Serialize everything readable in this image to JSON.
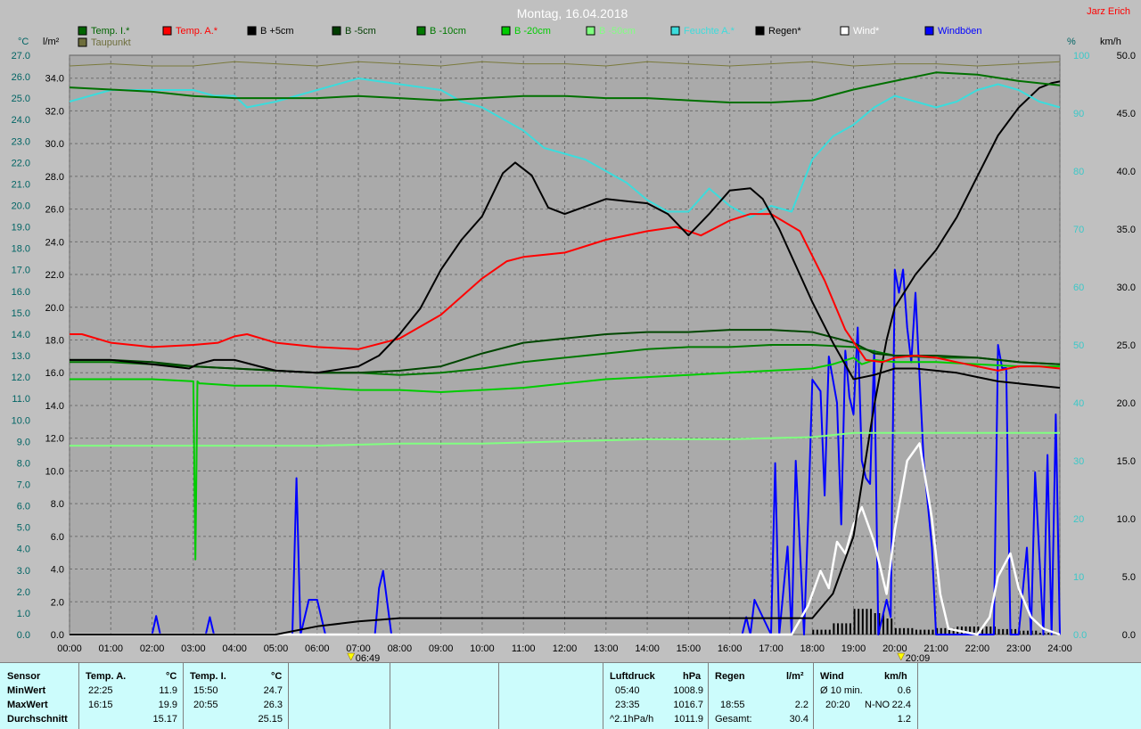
{
  "title": "Montag, 16.04.2018",
  "author": "Jarz Erich",
  "colors": {
    "temp_i": "#006400",
    "temp_a": "#ff0000",
    "b5": "#000000",
    "b_5": "#003c00",
    "b10": "#007800",
    "b20": "#00cc00",
    "b50": "#80ff80",
    "humidity": "#3cdcdc",
    "rain": "#000000",
    "wind": "#ffffff",
    "gusts": "#0000ff",
    "dew": "#6e6e3c"
  },
  "legend": [
    {
      "label": "Temp. I.*",
      "color": "#006400"
    },
    {
      "label": "Temp. A.*",
      "color": "#ff0000"
    },
    {
      "label": "B +5cm",
      "color": "#000000"
    },
    {
      "label": "B -5cm",
      "color": "#003c00"
    },
    {
      "label": "B -10cm",
      "color": "#007800"
    },
    {
      "label": "B -20cm",
      "color": "#00cc00"
    },
    {
      "label": "B -50cm",
      "color": "#80ff80"
    },
    {
      "label": "Feuchte A.*",
      "color": "#3cdcdc"
    },
    {
      "label": "Regen*",
      "color": "#000000"
    },
    {
      "label": "Wind*",
      "color": "#ffffff"
    },
    {
      "label": "Windböen",
      "color": "#0000ff"
    },
    {
      "label": "Taupunkt",
      "color": "#6e6e3c"
    }
  ],
  "chart_data": {
    "type": "line",
    "title": "Montag, 16.04.2018",
    "axes": {
      "left1": {
        "unit": "°C",
        "ylim": [
          0,
          27
        ],
        "ticks": [
          "0.0",
          "1.0",
          "2.0",
          "3.0",
          "4.0",
          "5.0",
          "6.0",
          "7.0",
          "8.0",
          "9.0",
          "10.0",
          "11.0",
          "12.0",
          "13.0",
          "14.0",
          "15.0",
          "16.0",
          "17.0",
          "18.0",
          "19.0",
          "20.0",
          "21.0",
          "22.0",
          "23.0",
          "24.0",
          "25.0",
          "26.0",
          "27.0"
        ]
      },
      "left2": {
        "unit": "l/m²",
        "ylim": [
          0,
          35.4
        ],
        "ticks": [
          "0.0",
          "2.0",
          "4.0",
          "6.0",
          "8.0",
          "10.0",
          "12.0",
          "14.0",
          "16.0",
          "18.0",
          "20.0",
          "22.0",
          "24.0",
          "26.0",
          "28.0",
          "30.0",
          "32.0",
          "34.0"
        ]
      },
      "right1": {
        "unit": "%",
        "ylim": [
          0,
          100
        ],
        "ticks": [
          "0.0",
          "10",
          "20",
          "30",
          "40",
          "50",
          "60",
          "70",
          "80",
          "90",
          "100"
        ]
      },
      "right2": {
        "unit": "km/h",
        "ylim": [
          0,
          50
        ],
        "ticks": [
          "0.0",
          "5.0",
          "10.0",
          "15.0",
          "20.0",
          "25.0",
          "30.0",
          "35.0",
          "40.0",
          "45.0",
          "50.0"
        ]
      },
      "x": {
        "ticks": [
          "00:00",
          "01:00",
          "02:00",
          "03:00",
          "04:00",
          "05:00",
          "06:00",
          "07:00",
          "08:00",
          "09:00",
          "10:00",
          "11:00",
          "12:00",
          "13:00",
          "14:00",
          "15:00",
          "16:00",
          "17:00",
          "18:00",
          "19:00",
          "20:00",
          "21:00",
          "22:00",
          "23:00",
          "24:00"
        ]
      }
    },
    "markers": [
      {
        "label": "06:49",
        "x": 6.82
      },
      {
        "label": "20:09",
        "x": 20.15
      }
    ],
    "grid": true,
    "series": [
      {
        "name": "Temp. I.*",
        "axis": "left1",
        "x": [
          0,
          1,
          2,
          3,
          4,
          5,
          6,
          7,
          8,
          9,
          10,
          11,
          12,
          13,
          14,
          15,
          16,
          17,
          18,
          19,
          20,
          21,
          22,
          23,
          24
        ],
        "values": [
          25.5,
          25.4,
          25.3,
          25.1,
          25.0,
          25.0,
          25.0,
          25.1,
          25.0,
          24.9,
          25.0,
          25.1,
          25.1,
          25.0,
          25.0,
          24.9,
          24.8,
          24.8,
          24.9,
          25.4,
          25.8,
          26.2,
          26.1,
          25.8,
          25.6
        ]
      },
      {
        "name": "Temp. A.*",
        "axis": "left1",
        "x": [
          0,
          0.3,
          1,
          2,
          3,
          3.6,
          4,
          4.3,
          5,
          6,
          7,
          8,
          9,
          10,
          10.6,
          11,
          12,
          13,
          14,
          14.7,
          15.3,
          16,
          16.5,
          17,
          17.7,
          18.3,
          18.8,
          19.3,
          19.7,
          20,
          20.5,
          21,
          21.5,
          22,
          22.5,
          23,
          23.5,
          24
        ],
        "values": [
          14.0,
          14.0,
          13.6,
          13.4,
          13.5,
          13.6,
          13.9,
          14.0,
          13.6,
          13.4,
          13.3,
          13.8,
          14.9,
          16.6,
          17.4,
          17.6,
          17.8,
          18.4,
          18.8,
          19.0,
          18.6,
          19.3,
          19.6,
          19.6,
          18.8,
          16.5,
          14.2,
          12.8,
          12.7,
          12.9,
          13.0,
          12.9,
          12.7,
          12.5,
          12.3,
          12.5,
          12.5,
          12.4
        ]
      },
      {
        "name": "B +5cm",
        "axis": "left1",
        "x": [
          0,
          1,
          2,
          2.9,
          3.1,
          3.5,
          4,
          4.6,
          5,
          6,
          7,
          7.5,
          8,
          8.5,
          9,
          9.5,
          10,
          10.5,
          10.8,
          11.2,
          11.6,
          12,
          13,
          13.5,
          14,
          14.5,
          15,
          15.5,
          16,
          16.5,
          16.8,
          17.2,
          17.6,
          18,
          18.5,
          19,
          19.5,
          20,
          20.5,
          21,
          21.5,
          22,
          22.5,
          23,
          23.5,
          24
        ],
        "values": [
          12.8,
          12.8,
          12.6,
          12.4,
          12.6,
          12.8,
          12.8,
          12.5,
          12.3,
          12.2,
          12.5,
          13.0,
          14.0,
          15.2,
          17.0,
          18.4,
          19.5,
          21.5,
          22.0,
          21.4,
          19.9,
          19.6,
          20.3,
          20.2,
          20.1,
          19.6,
          18.6,
          19.6,
          20.7,
          20.8,
          20.3,
          18.9,
          17.2,
          15.5,
          13.6,
          11.9,
          12.1,
          12.4,
          12.4,
          12.3,
          12.2,
          12.0,
          11.8,
          11.7,
          11.6,
          11.5
        ]
      },
      {
        "name": "B -5cm",
        "axis": "left1",
        "x": [
          0,
          1,
          2,
          3,
          4,
          5,
          6,
          7,
          8,
          9,
          10,
          11,
          12,
          13,
          14,
          15,
          16,
          17,
          18,
          19,
          19.5,
          20,
          21,
          22,
          23,
          24
        ],
        "values": [
          12.8,
          12.8,
          12.7,
          12.5,
          12.4,
          12.3,
          12.2,
          12.2,
          12.3,
          12.5,
          13.1,
          13.6,
          13.8,
          14.0,
          14.1,
          14.1,
          14.2,
          14.2,
          14.1,
          13.6,
          13.1,
          13.0,
          13.0,
          12.9,
          12.7,
          12.6
        ]
      },
      {
        "name": "B -10cm",
        "axis": "left1",
        "x": [
          0,
          1,
          2,
          3,
          4,
          5,
          6,
          7,
          8,
          9,
          10,
          11,
          12,
          13,
          14,
          15,
          16,
          17,
          18,
          19,
          20,
          21,
          22,
          23,
          24
        ],
        "values": [
          12.7,
          12.7,
          12.6,
          12.5,
          12.4,
          12.3,
          12.2,
          12.2,
          12.1,
          12.2,
          12.4,
          12.7,
          12.9,
          13.1,
          13.3,
          13.4,
          13.4,
          13.5,
          13.5,
          13.4,
          13.0,
          12.9,
          12.9,
          12.7,
          12.6
        ]
      },
      {
        "name": "B -20cm",
        "axis": "left1",
        "x": [
          0,
          1,
          2,
          3,
          3.05,
          3.1,
          3.15,
          3.2,
          4,
          5,
          6,
          7,
          8,
          9,
          10,
          11,
          12,
          13,
          14,
          15,
          16,
          17,
          18,
          18.5,
          19,
          19.2,
          19.5,
          20,
          21,
          22,
          23,
          24
        ],
        "values": [
          11.9,
          11.9,
          11.9,
          11.8,
          3.5,
          11.8,
          11.7,
          11.7,
          11.6,
          11.6,
          11.5,
          11.4,
          11.4,
          11.3,
          11.4,
          11.5,
          11.7,
          11.9,
          12.0,
          12.1,
          12.2,
          12.3,
          12.4,
          12.6,
          12.9,
          12.6,
          12.8,
          12.7,
          12.7,
          12.6,
          12.5,
          12.5
        ]
      },
      {
        "name": "B -50cm",
        "axis": "left1",
        "x": [
          0,
          2,
          3,
          4,
          6,
          8,
          10,
          12,
          14,
          16,
          18,
          19,
          20,
          22,
          24
        ],
        "values": [
          8.8,
          8.8,
          8.8,
          8.8,
          8.8,
          8.9,
          8.9,
          9.0,
          9.1,
          9.1,
          9.2,
          9.4,
          9.4,
          9.4,
          9.4
        ]
      },
      {
        "name": "Feuchte A.*",
        "axis": "right1",
        "x": [
          0,
          0.5,
          1,
          2,
          3,
          3.5,
          4,
          4.3,
          5,
          6,
          7,
          8,
          9,
          9.5,
          10,
          10.5,
          11,
          11.5,
          12,
          12.5,
          13,
          13.5,
          14,
          14.5,
          15,
          15.5,
          16,
          16.5,
          17,
          17.5,
          18,
          18.5,
          19,
          19.5,
          20,
          20.5,
          21,
          21.5,
          22,
          22.5,
          23,
          23.5,
          24
        ],
        "values": [
          92,
          93,
          94,
          94,
          94,
          93,
          93,
          91,
          92,
          94,
          96,
          95,
          94,
          92,
          91,
          89,
          87,
          84,
          83,
          82,
          80,
          78,
          75,
          73,
          73,
          77,
          74,
          72,
          74,
          73,
          82,
          86,
          88,
          91,
          93,
          92,
          91,
          92,
          94,
          95,
          94,
          92,
          91
        ]
      },
      {
        "name": "Regen*",
        "axis": "left2",
        "x": [
          0,
          5,
          6,
          7,
          7.5,
          8,
          9,
          10,
          11,
          12,
          13,
          14,
          15,
          16,
          17,
          17.5,
          18,
          18.5,
          19,
          19.5,
          19.8,
          20,
          20.5,
          21,
          21.5,
          22,
          22.5,
          23,
          23.5,
          23.8,
          24
        ],
        "values": [
          0,
          0,
          0.5,
          0.8,
          0.9,
          1.0,
          1.0,
          1.0,
          1.0,
          1.0,
          1.0,
          1.0,
          1.0,
          1.0,
          1.0,
          1.0,
          1.0,
          2.5,
          6.0,
          14.0,
          18.0,
          20.0,
          22.0,
          23.5,
          25.5,
          28.0,
          30.5,
          32.2,
          33.4,
          33.7,
          33.8
        ]
      },
      {
        "name": "Wind*",
        "axis": "right2",
        "x": [
          0,
          17.5,
          17.9,
          18.2,
          18.4,
          18.6,
          18.8,
          19.0,
          19.2,
          19.5,
          19.8,
          20.0,
          20.3,
          20.6,
          20.9,
          21.1,
          21.3,
          22.0,
          22.3,
          22.5,
          22.8,
          23.0,
          23.3,
          23.6,
          24
        ],
        "values": [
          0,
          0,
          2.5,
          5.5,
          4.0,
          8.0,
          7.0,
          9.5,
          11.0,
          8.0,
          3.5,
          9.0,
          15.0,
          16.5,
          10.0,
          3.5,
          0.5,
          0,
          1.5,
          5.0,
          7.0,
          4.0,
          1.5,
          0.5,
          0
        ]
      },
      {
        "name": "Windböen",
        "axis": "right2",
        "x": [
          0,
          2.0,
          2.1,
          2.2,
          3.3,
          3.4,
          3.5,
          5.4,
          5.5,
          5.6,
          5.8,
          6.0,
          6.2,
          7.4,
          7.5,
          7.6,
          7.8,
          16.3,
          16.4,
          16.5,
          16.6,
          17.0,
          17.1,
          17.2,
          17.4,
          17.5,
          17.6,
          17.8,
          17.9,
          18.0,
          18.2,
          18.3,
          18.4,
          18.6,
          18.7,
          18.8,
          18.9,
          19.0,
          19.1,
          19.2,
          19.3,
          19.4,
          19.5,
          19.6,
          19.8,
          19.9,
          20.0,
          20.1,
          20.2,
          20.3,
          20.4,
          20.5,
          20.7,
          20.9,
          21.0,
          22.4,
          22.5,
          22.6,
          22.7,
          22.8,
          23.0,
          23.2,
          23.3,
          23.4,
          23.6,
          23.7,
          23.8,
          23.9,
          24.0
        ],
        "values": [
          0,
          0,
          1.6,
          0,
          0,
          1.5,
          0,
          0,
          13.5,
          0,
          3.0,
          3.0,
          0,
          0,
          4.0,
          5.5,
          0,
          0,
          1.5,
          0,
          3.0,
          0,
          14.8,
          0,
          7.6,
          0,
          15.0,
          0,
          10.0,
          22.0,
          21.0,
          12.0,
          24.0,
          20.0,
          9.5,
          24.5,
          20.5,
          19.0,
          26.5,
          15.0,
          13.5,
          13.0,
          24.5,
          0,
          3.0,
          1.5,
          31.5,
          29.5,
          31.5,
          26.5,
          23.5,
          29.5,
          15.0,
          7.5,
          0,
          0,
          25.0,
          23.0,
          23.0,
          0,
          0,
          7.5,
          0,
          14.0,
          0,
          15.5,
          0,
          19.0,
          0
        ]
      },
      {
        "name": "Taupunkt",
        "axis": "left1",
        "x": [
          0,
          1,
          2,
          3,
          4,
          5,
          6,
          7,
          8,
          9,
          10,
          11,
          12,
          13,
          14,
          15,
          16,
          17,
          18,
          19,
          20,
          21,
          22,
          23,
          24
        ],
        "values": [
          26.5,
          26.6,
          26.5,
          26.5,
          26.7,
          26.6,
          26.5,
          26.7,
          26.6,
          26.5,
          26.7,
          26.6,
          26.6,
          26.5,
          26.7,
          26.6,
          26.5,
          26.6,
          26.7,
          26.5,
          26.6,
          26.6,
          26.5,
          26.6,
          26.7
        ]
      }
    ]
  },
  "stats": {
    "sensor": {
      "title": "Sensor",
      "rows": [
        "MinWert",
        "MaxWert",
        "Durchschnitt"
      ]
    },
    "temp_a": {
      "title": "Temp. A.",
      "unit": "°C",
      "min_time": "22:25",
      "min": "11.9",
      "max_time": "16:15",
      "max": "19.9",
      "avg": "15.17"
    },
    "temp_i": {
      "title": "Temp. I.",
      "unit": "°C",
      "min_time": "15:50",
      "min": "24.7",
      "max_time": "20:55",
      "max": "26.3",
      "avg": "25.15"
    },
    "pressure": {
      "title": "Luftdruck",
      "unit": "hPa",
      "min_time": "05:40",
      "min": "1008.9",
      "max_time": "23:35",
      "max": "1016.7",
      "trend_label": "^2.1hPa/h",
      "avg": "1011.9"
    },
    "rain": {
      "title": "Regen",
      "unit": "l/m²",
      "time": "18:55",
      "rate": "2.2",
      "total_label": "Gesamt:",
      "total": "30.4"
    },
    "wind": {
      "title": "Wind",
      "unit": "km/h",
      "avg_label": "Ø 10 min.",
      "avg": "0.6",
      "max_time": "20:20",
      "max_dir": "N-NO",
      "max": "22.4",
      "mean": "1.2"
    }
  }
}
